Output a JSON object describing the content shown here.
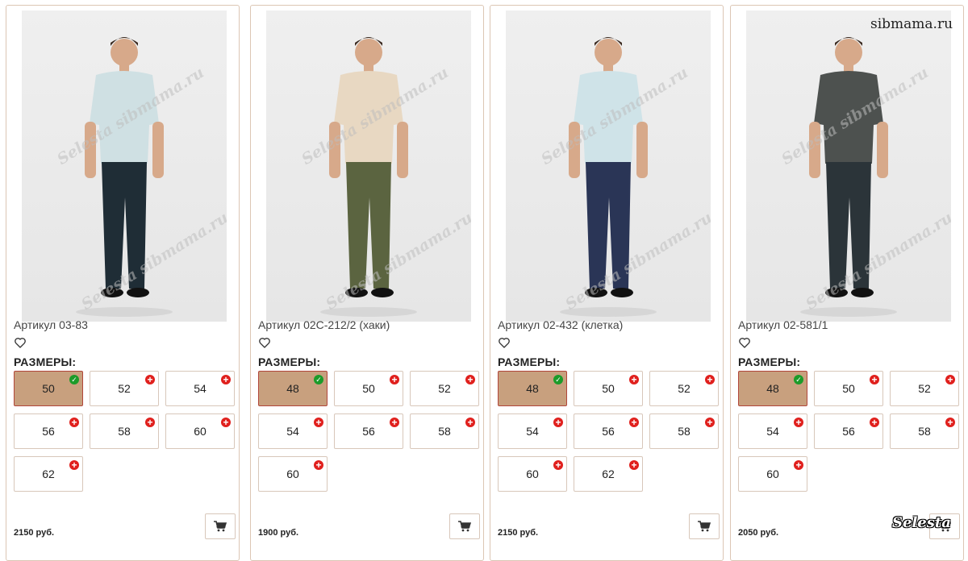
{
  "watermarks": {
    "site": "sibmama.ru",
    "brand": "Selesta",
    "diagonal": "Selesta sibmama.ru"
  },
  "colors": {
    "selected_bg": "#c8a07e",
    "selected_border": "#b1463a",
    "add_badge": "#e0201d",
    "ok_badge": "#1c9b2a",
    "card_border": "#dcc6b4"
  },
  "icons": {
    "favorite": "heart-outline-icon",
    "cart": "cart-icon",
    "available": "plus-circle-icon",
    "chosen": "check-circle-icon"
  },
  "products": [
    {
      "title": "Артикул 03-83",
      "sizes_label": "РАЗМЕРЫ:",
      "sizes": [
        "50",
        "52",
        "54",
        "56",
        "58",
        "60",
        "62"
      ],
      "selected": "50",
      "price": "2150 руб.",
      "outfit": {
        "top": "#cfe0e3",
        "bottom": "#1f2d36"
      }
    },
    {
      "title": "Артикул 02С-212/2 (хаки)",
      "sizes_label": "РАЗМЕРЫ:",
      "sizes": [
        "48",
        "50",
        "52",
        "54",
        "56",
        "58",
        "60"
      ],
      "selected": "48",
      "price": "1900 руб.",
      "outfit": {
        "top": "#e8d8c2",
        "bottom": "#5b6440"
      }
    },
    {
      "title": "Артикул 02-432 (клетка)",
      "sizes_label": "РАЗМЕРЫ:",
      "sizes": [
        "48",
        "50",
        "52",
        "54",
        "56",
        "58",
        "60",
        "62"
      ],
      "selected": "48",
      "price": "2150 руб.",
      "outfit": {
        "top": "#cfe3e8",
        "bottom": "#2a3556"
      }
    },
    {
      "title": "Артикул 02-581/1",
      "sizes_label": "РАЗМЕРЫ:",
      "sizes": [
        "48",
        "50",
        "52",
        "54",
        "56",
        "58",
        "60"
      ],
      "selected": "48",
      "price": "2050 руб.",
      "outfit": {
        "top": "#4d514f",
        "bottom": "#2b3439"
      }
    }
  ]
}
